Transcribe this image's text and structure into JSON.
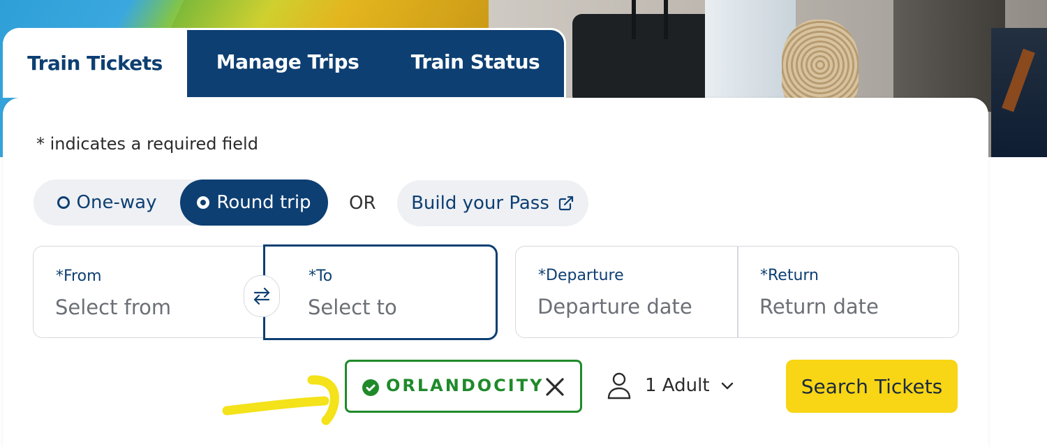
{
  "tabs": {
    "train_tickets": "Train Tickets",
    "manage_trips": "Manage Trips",
    "train_status": "Train Status"
  },
  "form": {
    "required_note": "* indicates a required field",
    "trip_type": {
      "one_way": "One-way",
      "round_trip": "Round trip",
      "selected": "Round trip"
    },
    "or_text": "OR",
    "build_pass": "Build your Pass",
    "from": {
      "label": "*From",
      "placeholder": "Select from"
    },
    "to": {
      "label": "*To",
      "placeholder": "Select to"
    },
    "departure": {
      "label": "*Departure",
      "placeholder": "Departure date"
    },
    "return": {
      "label": "*Return",
      "placeholder": "Return date"
    },
    "promo_code": "ORLANDOCITY",
    "passengers": "1 Adult",
    "search_button": "Search Tickets"
  },
  "colors": {
    "brand_navy": "#0d3f72",
    "accent_yellow": "#f8d515",
    "success_green": "#1f8a2a"
  },
  "icons": [
    "swap-icon",
    "external-link-icon",
    "check-circle-icon",
    "close-icon",
    "person-icon",
    "chevron-down-icon"
  ]
}
